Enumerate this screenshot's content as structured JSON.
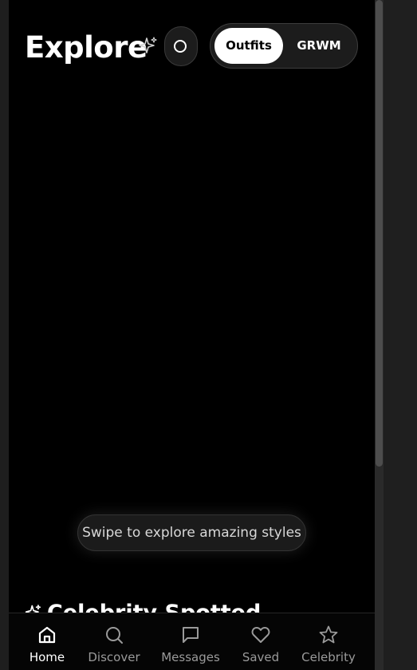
{
  "header": {
    "title": "Explore",
    "sparkle_icon": "sparkle-icon",
    "circle_button_icon": "circle-icon"
  },
  "mode_toggle": {
    "options": [
      {
        "label": "Outfits",
        "active": true
      },
      {
        "label": "GRWM",
        "active": false
      }
    ]
  },
  "swipe_hint": "Swipe to explore amazing styles",
  "next_section": {
    "title": "Celebrity Spotted",
    "icon": "sparkle-icon"
  },
  "tabbar": {
    "items": [
      {
        "label": "Home",
        "icon": "home-icon",
        "active": true
      },
      {
        "label": "Discover",
        "icon": "search-icon",
        "active": false
      },
      {
        "label": "Messages",
        "icon": "message-icon",
        "active": false
      },
      {
        "label": "Saved",
        "icon": "heart-icon",
        "active": false
      },
      {
        "label": "Celebrity",
        "icon": "star-icon",
        "active": false
      }
    ]
  },
  "colors": {
    "background": "#000000",
    "accent": "#ffffff",
    "inactive_text": "#9a9a9a"
  }
}
